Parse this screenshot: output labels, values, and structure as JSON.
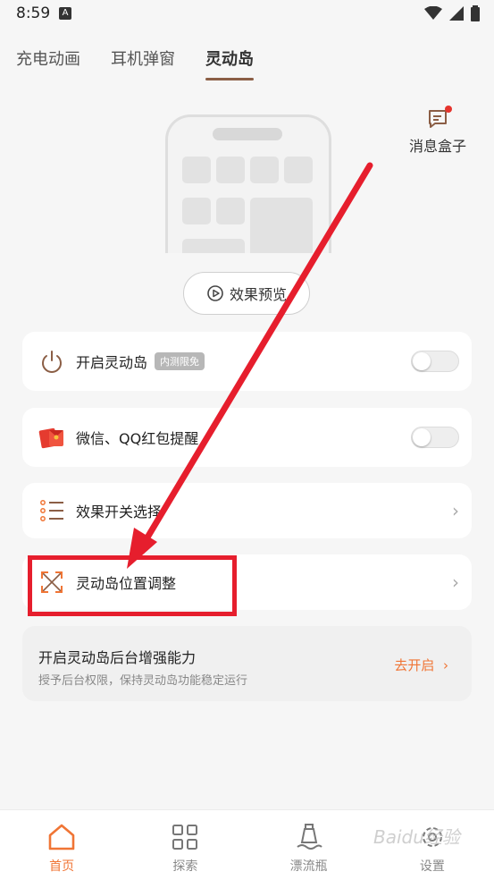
{
  "status_bar": {
    "time": "8:59",
    "notification_letter": "A"
  },
  "tabs": [
    {
      "label": "充电动画",
      "active": false
    },
    {
      "label": "耳机弹窗",
      "active": false
    },
    {
      "label": "灵动岛",
      "active": true
    }
  ],
  "message_box": {
    "label": "消息盒子"
  },
  "preview": {
    "label": "效果预览"
  },
  "settings": {
    "island": {
      "label": "开启灵动岛",
      "badge": "内测限免",
      "enabled": false
    },
    "redpacket": {
      "label": "微信、QQ红包提醒",
      "enabled": false
    },
    "effects": {
      "label": "效果开关选择"
    },
    "position": {
      "label": "灵动岛位置调整"
    }
  },
  "background_card": {
    "title": "开启灵动岛后台增强能力",
    "subtitle": "授予后台权限，保持灵动岛功能稳定运行",
    "action": "去开启"
  },
  "bottom_nav": [
    {
      "label": "首页",
      "active": true
    },
    {
      "label": "探索",
      "active": false
    },
    {
      "label": "漂流瓶",
      "active": false
    },
    {
      "label": "设置",
      "active": false
    }
  ],
  "watermark": "Baidu经验",
  "colors": {
    "accent": "#f07535",
    "annotation": "#e61e2d",
    "tab_underline": "#8b5e45"
  }
}
